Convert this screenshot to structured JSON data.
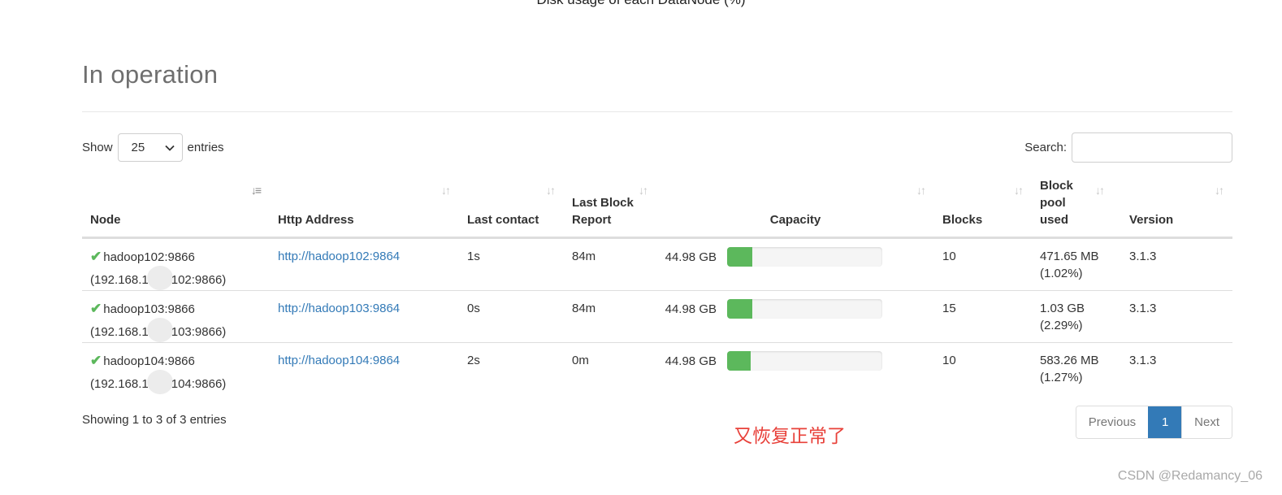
{
  "top_caption": "Disk usage of each DataNode (%)",
  "section_title": "In operation",
  "length_control": {
    "show_label": "Show",
    "selected": "25",
    "entries_label": "entries"
  },
  "search": {
    "label": "Search:",
    "value": "",
    "placeholder": ""
  },
  "columns": [
    {
      "label": "Node",
      "sort": "active"
    },
    {
      "label": "Http Address",
      "sort": "both"
    },
    {
      "label": "Last contact",
      "sort": "both"
    },
    {
      "label": "Last Block Report",
      "sort": "both"
    },
    {
      "label": "Capacity",
      "sort": "both"
    },
    {
      "label": "Blocks",
      "sort": "both"
    },
    {
      "label": "Block pool used",
      "sort": "both"
    },
    {
      "label": "Version",
      "sort": "both"
    }
  ],
  "rows": [
    {
      "node": "hadoop102:9866",
      "ip_prefix": "(192.168.1",
      "ip_suffix": "102:9866)",
      "http": "http://hadoop102:9864",
      "last_contact": "1s",
      "last_block_report": "84m",
      "capacity": "44.98 GB",
      "capacity_used_pct": 16,
      "blocks": "10",
      "pool_used": "471.65 MB",
      "pool_pct": "(1.02%)",
      "version": "3.1.3"
    },
    {
      "node": "hadoop103:9866",
      "ip_prefix": "(192.168.1",
      "ip_suffix": "103:9866)",
      "http": "http://hadoop103:9864",
      "last_contact": "0s",
      "last_block_report": "84m",
      "capacity": "44.98 GB",
      "capacity_used_pct": 16,
      "blocks": "15",
      "pool_used": "1.03 GB",
      "pool_pct": "(2.29%)",
      "version": "3.1.3"
    },
    {
      "node": "hadoop104:9866",
      "ip_prefix": "(192.168.1",
      "ip_suffix": "104:9866)",
      "http": "http://hadoop104:9864",
      "last_contact": "2s",
      "last_block_report": "0m",
      "capacity": "44.98 GB",
      "capacity_used_pct": 15,
      "blocks": "10",
      "pool_used": "583.26 MB",
      "pool_pct": "(1.27%)",
      "version": "3.1.3"
    }
  ],
  "info_text": "Showing 1 to 3 of 3 entries",
  "pagination": {
    "previous": "Previous",
    "current": "1",
    "next": "Next"
  },
  "annotation": "又恢复正常了",
  "watermark": "CSDN @Redamancy_06",
  "colors": {
    "ok": "#5cb85c",
    "link": "#337ab7",
    "annotation": "#e8413a"
  }
}
